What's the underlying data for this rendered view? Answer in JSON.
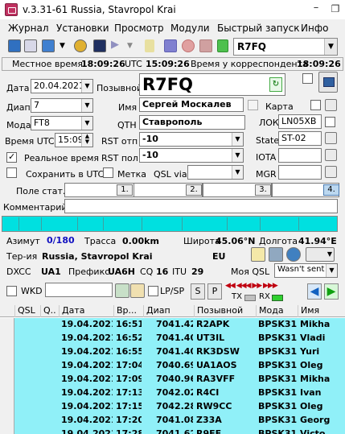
{
  "window": {
    "title": "v.3.31-61 Russia, Stavropol Krai",
    "min": "–",
    "restore": "❐"
  },
  "menu": [
    "Журнал",
    "Установки",
    "Просмотр",
    "Модули",
    "Быстрый запуск",
    "Инфо"
  ],
  "toolbar": {
    "callsign": "R7FQ"
  },
  "timebar": {
    "local_label": "Местное время",
    "local": "18:09:26",
    "utc_label": "UTC",
    "utc": "15:09:26",
    "corr_label": "Время у корреспондента",
    "corr": "18:09:26"
  },
  "form": {
    "date_label": "Дата",
    "date": "20.04.2021",
    "callsign_label": "Позывной",
    "callsign": "R7FQ",
    "band_label": "Диап",
    "band": "7",
    "name_label": "Имя",
    "name": "Сергей Москалев",
    "map_label": "Карта",
    "mode_label": "Мода",
    "mode": "FT8",
    "qth_label": "QTH",
    "qth": "Ставрополь",
    "loc_label": "ЛОК",
    "loc": "LN05XB",
    "utc_label": "Время UTC",
    "utc": "15:09",
    "rst_s_label": "RST отп",
    "rst_s": "-10",
    "state_label": "State",
    "state": "ST-02",
    "realtime_label": "Реальное время",
    "rst_r_label": "RST пол",
    "rst_r": "-10",
    "iota_label": "IOTA",
    "iota": "",
    "save_utc_label": "Сохранить в UTC",
    "mark_label": "Метка",
    "qslvia_label": "QSL via",
    "qslvia": "",
    "mgr_label": "MGR",
    "mgr": "",
    "stat_label": "Поле стат.",
    "n1": "1.",
    "n2": "2.",
    "n3": "3.",
    "n4": "4.",
    "comment_label": "Комментарий",
    "comment": ""
  },
  "info": {
    "az_label": "Азимут",
    "az": "0/180",
    "track_label": "Трасса",
    "track": "0.00km",
    "lat_label": "Широта",
    "lat": "45.06°N",
    "lon_label": "Долгота",
    "lon": "41.94°E",
    "terr_label": "Тер-ия",
    "terr": "Russia, Stavropol Krai",
    "cont": "EU",
    "dxcc_label": "DXCC",
    "dxcc": "UA1",
    "prefix_label": "Префикс",
    "prefix": "UA6H",
    "cq_label": "CQ",
    "cq": "16",
    "itu_label": "ITU",
    "itu": "29",
    "myqsl_label": "Моя QSL",
    "myqsl": "Wasn't sent"
  },
  "wkd": {
    "label": "WKD",
    "value": "",
    "lpsp": "LP/SP",
    "s": "S",
    "p": "P",
    "tx": "TX",
    "rx": "RX"
  },
  "table": {
    "headers": [
      "QSL",
      "Q..",
      "Дата",
      "Вр...",
      "Диап",
      "Позывной",
      "Мода",
      "Имя"
    ],
    "rows": [
      [
        "",
        "",
        "19.04.2021",
        "16:51",
        "7041.42",
        "R2APK",
        "BPSK31",
        "Mikha"
      ],
      [
        "",
        "",
        "19.04.2021",
        "16:52",
        "7041.40",
        "UT3IL",
        "BPSK31",
        "Vladi"
      ],
      [
        "",
        "",
        "19.04.2021",
        "16:55",
        "7041.40",
        "RK3DSW",
        "BPSK31",
        "Yuri"
      ],
      [
        "",
        "",
        "19.04.2021",
        "17:04",
        "7040.69",
        "UA1AOS",
        "BPSK31",
        "Oleg"
      ],
      [
        "",
        "",
        "19.04.2021",
        "17:09",
        "7040.96",
        "RA3VFF",
        "BPSK31",
        "Mikha"
      ],
      [
        "",
        "",
        "19.04.2021",
        "17:13",
        "7042.02",
        "R4CI",
        "BPSK31",
        "Ivan"
      ],
      [
        "",
        "",
        "19.04.2021",
        "17:15",
        "7042.28",
        "RW9CC",
        "BPSK31",
        "Oleg"
      ],
      [
        "",
        "",
        "19.04.2021",
        "17:20",
        "7041.08",
        "Z33A",
        "BPSK31",
        "Georg"
      ],
      [
        "",
        "",
        "19.04.2021",
        "17:28",
        "7041.62",
        "R9FE",
        "BPSK31",
        "Victo"
      ]
    ]
  }
}
